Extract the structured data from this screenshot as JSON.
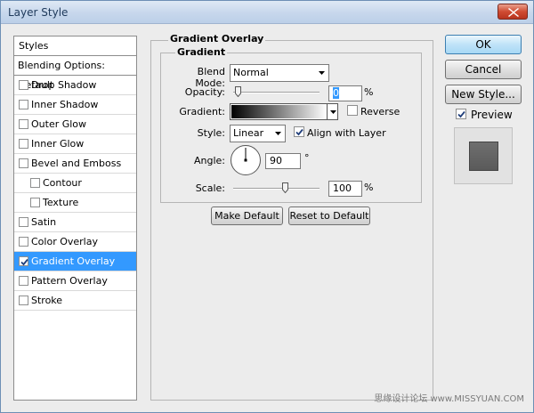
{
  "window": {
    "title": "Layer Style"
  },
  "styles_list": {
    "header": "Styles",
    "blending_options": "Blending Options: Default",
    "items": [
      {
        "label": "Drop Shadow",
        "checked": false,
        "sub": false,
        "selected": false
      },
      {
        "label": "Inner Shadow",
        "checked": false,
        "sub": false,
        "selected": false
      },
      {
        "label": "Outer Glow",
        "checked": false,
        "sub": false,
        "selected": false
      },
      {
        "label": "Inner Glow",
        "checked": false,
        "sub": false,
        "selected": false
      },
      {
        "label": "Bevel and Emboss",
        "checked": false,
        "sub": false,
        "selected": false
      },
      {
        "label": "Contour",
        "checked": false,
        "sub": true,
        "selected": false
      },
      {
        "label": "Texture",
        "checked": false,
        "sub": true,
        "selected": false
      },
      {
        "label": "Satin",
        "checked": false,
        "sub": false,
        "selected": false
      },
      {
        "label": "Color Overlay",
        "checked": false,
        "sub": false,
        "selected": false
      },
      {
        "label": "Gradient Overlay",
        "checked": true,
        "sub": false,
        "selected": true
      },
      {
        "label": "Pattern Overlay",
        "checked": false,
        "sub": false,
        "selected": false
      },
      {
        "label": "Stroke",
        "checked": false,
        "sub": false,
        "selected": false
      }
    ]
  },
  "panel": {
    "group_title": "Gradient Overlay",
    "sub_title": "Gradient",
    "blend_mode_label": "Blend Mode:",
    "blend_mode_value": "Normal",
    "opacity_label": "Opacity:",
    "opacity_value": "0",
    "opacity_unit": "%",
    "opacity_level": 0.05,
    "gradient_label": "Gradient:",
    "reverse_label": "Reverse",
    "reverse_checked": false,
    "style_label": "Style:",
    "style_value": "Linear",
    "align_label": "Align with Layer",
    "align_checked": true,
    "angle_label": "Angle:",
    "angle_value": "90",
    "angle_unit": "°",
    "scale_label": "Scale:",
    "scale_value": "100",
    "scale_unit": "%",
    "scale_level": 0.6,
    "make_default": "Make Default",
    "reset_default": "Reset to Default"
  },
  "buttons": {
    "ok": "OK",
    "cancel": "Cancel",
    "new_style": "New Style...",
    "preview_label": "Preview",
    "preview_checked": true
  },
  "watermark": "思缘设计论坛  www.MISSYUAN.COM",
  "colors": {
    "selection": "#3399ff",
    "preview_swatch": "#636363"
  },
  "icons": [
    "close-icon",
    "checkmark-icon",
    "dropdown-arrow-icon",
    "slider-thumb-icon",
    "angle-dial-icon"
  ]
}
